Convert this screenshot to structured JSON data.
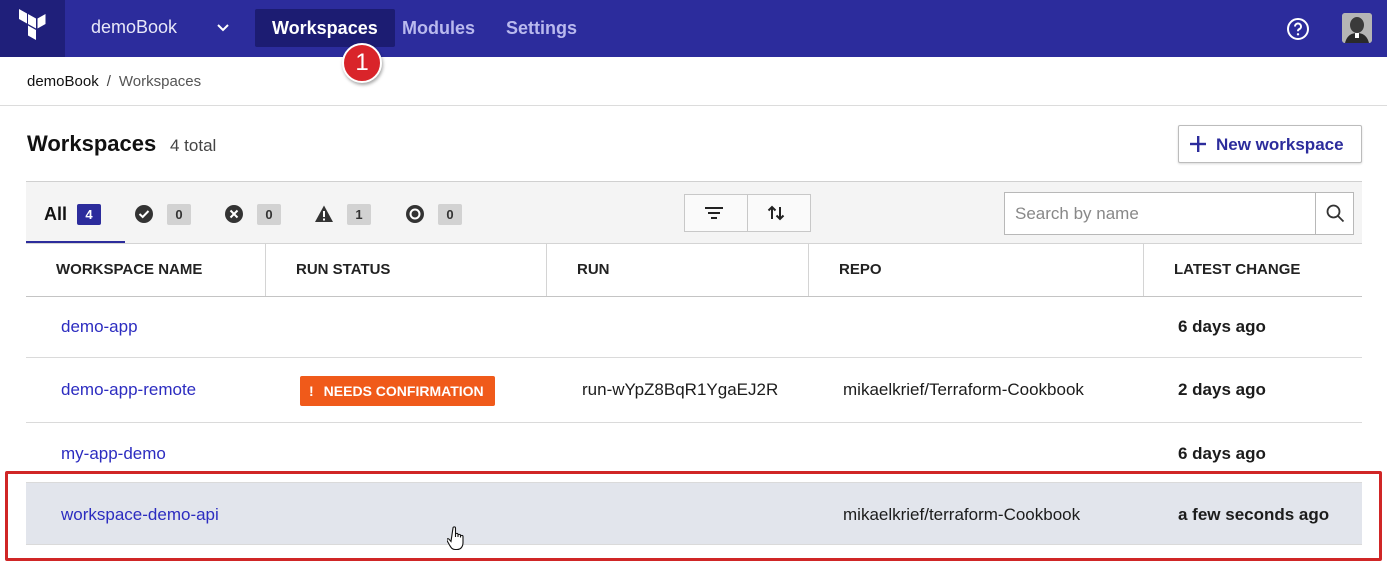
{
  "topbar": {
    "org": "demoBook",
    "nav": [
      "Workspaces",
      "Modules",
      "Settings"
    ],
    "active_nav": "Workspaces",
    "callout_number": "1"
  },
  "breadcrumb": {
    "org": "demoBook",
    "separator": "/",
    "page": "Workspaces"
  },
  "header": {
    "title": "Workspaces",
    "total": "4 total",
    "new_button": "New workspace"
  },
  "filters": {
    "all_label": "All",
    "all_count": "4",
    "success_count": "0",
    "error_count": "0",
    "warning_count": "1",
    "paused_count": "0"
  },
  "search": {
    "placeholder": "Search by name"
  },
  "table": {
    "headers": [
      "WORKSPACE NAME",
      "RUN STATUS",
      "RUN",
      "REPO",
      "LATEST CHANGE"
    ],
    "rows": [
      {
        "name": "demo-app",
        "status": "",
        "run": "",
        "repo": "",
        "latest": "6 days ago"
      },
      {
        "name": "demo-app-remote",
        "status": "NEEDS CONFIRMATION",
        "run": "run-wYpZ8BqR1YgaEJ2R",
        "repo": "mikaelkrief/Terraform-Cookbook",
        "latest": "2 days ago"
      },
      {
        "name": "my-app-demo",
        "status": "",
        "run": "",
        "repo": "",
        "latest": "6 days ago"
      },
      {
        "name": "workspace-demo-api",
        "status": "",
        "run": "",
        "repo": "mikaelkrief/terraform-Cookbook",
        "latest": "a few seconds ago"
      }
    ]
  },
  "colors": {
    "topbar": "#2c2c9c",
    "link": "#2c2cc0",
    "needs_confirmation": "#f05a1a",
    "highlight": "#d02626",
    "callout": "#d9242a"
  }
}
